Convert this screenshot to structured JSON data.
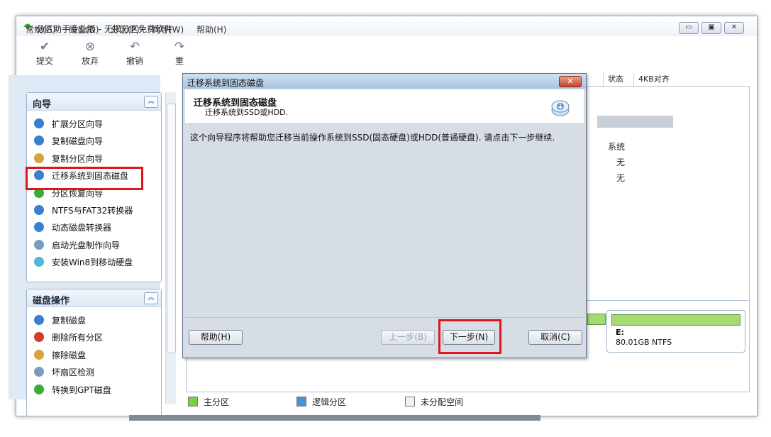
{
  "window": {
    "title": "分区助手专业版 - 无损分区免费软件",
    "controls": {
      "minimize": "▭",
      "maximize": "▣",
      "close": "✕"
    }
  },
  "menu": [
    "常规(G)",
    "磁盘(D)",
    "分区(P)",
    "向导(W)",
    "帮助(H)"
  ],
  "toolbar": [
    {
      "label": "提交",
      "icon": "check-icon"
    },
    {
      "label": "放弃",
      "icon": "discard-icon"
    },
    {
      "label": "撤销",
      "icon": "undo-icon"
    },
    {
      "label": "重",
      "icon": "redo-icon"
    }
  ],
  "sidebar": {
    "wizard_panel": {
      "title": "向导",
      "items": [
        {
          "label": "扩展分区向导",
          "icon": "extend-partition-icon",
          "color": "#3b7ed0"
        },
        {
          "label": "复制磁盘向导",
          "icon": "copy-disk-icon",
          "color": "#3b7ed0"
        },
        {
          "label": "复制分区向导",
          "icon": "copy-partition-icon",
          "color": "#d9a23a"
        },
        {
          "label": "迁移系统到固态磁盘",
          "icon": "migrate-ssd-icon",
          "color": "#3b7ed0"
        },
        {
          "label": "分区恢复向导",
          "icon": "partition-recovery-icon",
          "color": "#3bab3b"
        },
        {
          "label": "NTFS与FAT32转换器",
          "icon": "ntfs-fat32-icon",
          "color": "#3b7ed0"
        },
        {
          "label": "动态磁盘转换器",
          "icon": "dynamic-disk-icon",
          "color": "#3b7ed0"
        },
        {
          "label": "启动光盘制作向导",
          "icon": "boot-cd-icon",
          "color": "#7a9cc0"
        },
        {
          "label": "安装Win8到移动硬盘",
          "icon": "win8-usb-icon",
          "color": "#52b7d6"
        }
      ]
    },
    "disk_panel": {
      "title": "磁盘操作",
      "items": [
        {
          "label": "复制磁盘",
          "icon": "copy-disk-icon",
          "color": "#3b7ed0"
        },
        {
          "label": "删除所有分区",
          "icon": "delete-partitions-icon",
          "color": "#d23a2a"
        },
        {
          "label": "擦除磁盘",
          "icon": "wipe-disk-icon",
          "color": "#d9a23a"
        },
        {
          "label": "坏扇区检测",
          "icon": "bad-sector-icon",
          "color": "#7a9cc0"
        },
        {
          "label": "转换到GPT磁盘",
          "icon": "gpt-convert-icon",
          "color": "#3bab3b"
        }
      ]
    }
  },
  "table": {
    "headers": [
      "状态",
      "4KB对齐"
    ],
    "status_values": [
      "系统",
      "无",
      "无"
    ]
  },
  "disk_card": {
    "letter": "E:",
    "size": "80.01GB NTFS"
  },
  "legend": [
    {
      "label": "主分区",
      "color": "#7ccf3e"
    },
    {
      "label": "逻辑分区",
      "color": "#4a8fe0"
    },
    {
      "label": "未分配空间",
      "color": "#f2f2f2"
    }
  ],
  "dialog": {
    "title": "迁移系统到固态磁盘",
    "heading": "迁移系统到固态磁盘",
    "subheading": "迁移系统到SSD或HDD.",
    "body": "这个向导程序将帮助您迁移当前操作系统到SSD(固态硬盘)或HDD(普通硬盘). 请点击下一步继续.",
    "help_label": "帮助(H)",
    "back_label": "上一步(B)",
    "next_label": "下一步(N)",
    "cancel_label": "取消(C)",
    "close_glyph": "✕"
  },
  "colors": {
    "highlight": "#e0141e"
  }
}
